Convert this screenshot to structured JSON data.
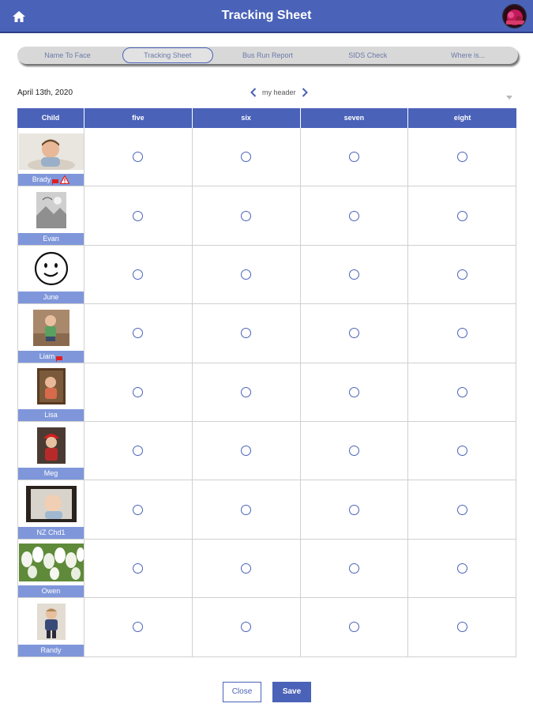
{
  "header": {
    "title": "Tracking Sheet",
    "home_icon": "home-icon",
    "avatar_icon": "user-avatar"
  },
  "tabs": [
    {
      "label": "Name To Face",
      "active": false
    },
    {
      "label": "Tracking Sheet",
      "active": true
    },
    {
      "label": "Bus Run Report",
      "active": false
    },
    {
      "label": "SIDS Check",
      "active": false
    },
    {
      "label": "Where is...",
      "active": false
    }
  ],
  "toolbar": {
    "date": "April 13th, 2020",
    "header_label": "my header",
    "prev_icon": "chevron-left-icon",
    "next_icon": "chevron-right-icon",
    "dropdown_icon": "caret-down-icon"
  },
  "table": {
    "columns": [
      "Child",
      "five",
      "six",
      "seven",
      "eight"
    ],
    "rows": [
      {
        "name": "Brady",
        "flag": true,
        "warning": true,
        "photo": "boy-photo"
      },
      {
        "name": "Evan",
        "flag": false,
        "warning": false,
        "photo": "placeholder-photo"
      },
      {
        "name": "June",
        "flag": false,
        "warning": false,
        "photo": "smiley-drawing"
      },
      {
        "name": "Liam",
        "flag": true,
        "warning": false,
        "photo": "toddler-photo"
      },
      {
        "name": "Lisa",
        "flag": false,
        "warning": false,
        "photo": "child-photo"
      },
      {
        "name": "Meg",
        "flag": false,
        "warning": false,
        "photo": "child-red-hat-photo"
      },
      {
        "name": "NZ Chd1",
        "flag": false,
        "warning": false,
        "photo": "baby-photo"
      },
      {
        "name": "Owen",
        "flag": false,
        "warning": false,
        "photo": "tulips-photo"
      },
      {
        "name": "Randy",
        "flag": false,
        "warning": false,
        "photo": "toddler-standing-photo"
      }
    ]
  },
  "buttons": {
    "close_label": "Close",
    "save_label": "Save"
  },
  "colors": {
    "brand": "#4a62b8",
    "name_bar": "#7f97da",
    "flag": "#e02020",
    "warning": "#e02020"
  }
}
